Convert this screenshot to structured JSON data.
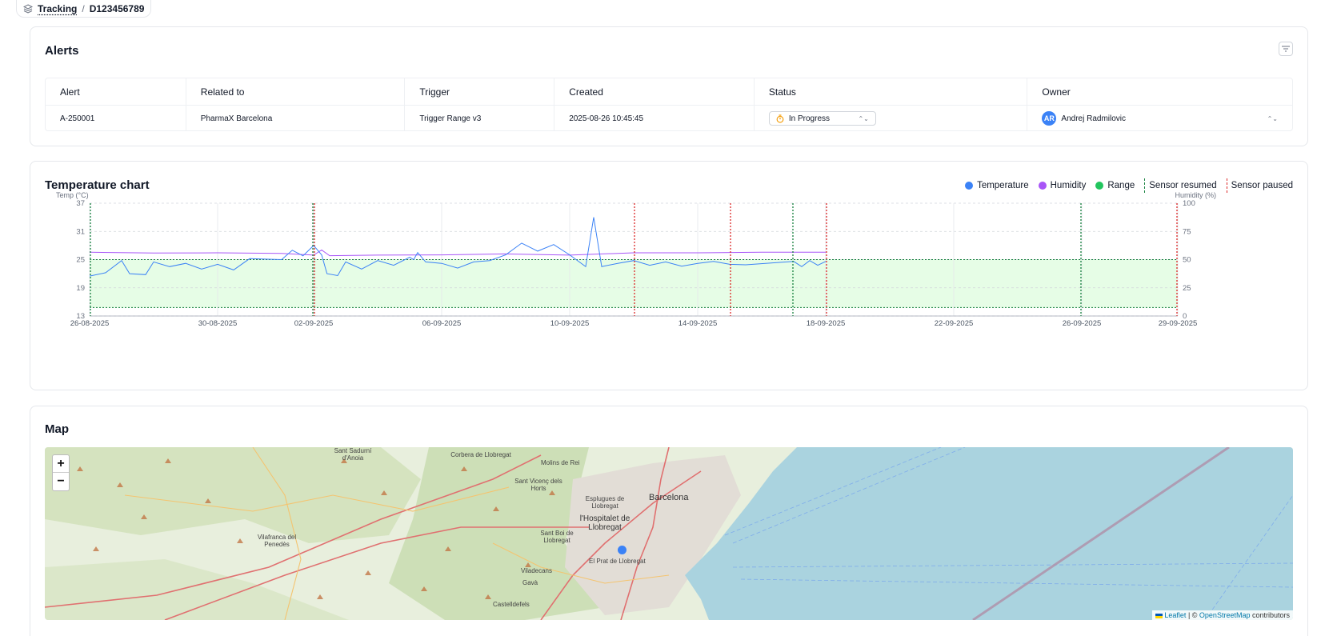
{
  "breadcrumb": {
    "root": "Tracking",
    "separator": "/",
    "current": "D123456789"
  },
  "alerts": {
    "title": "Alerts",
    "columns": [
      "Alert",
      "Related to",
      "Trigger",
      "Created",
      "Status",
      "Owner"
    ],
    "rows": [
      {
        "alert": "A-250001",
        "related": "PharmaX Barcelona",
        "trigger": "Trigger Range v3",
        "created": "2025-08-26 10:45:45",
        "status": "In Progress",
        "owner_initials": "AR",
        "owner": "Andrej Radmilovic"
      }
    ]
  },
  "chart": {
    "title": "Temperature chart",
    "legend": {
      "temperature": "Temperature",
      "humidity": "Humidity",
      "range": "Range",
      "resumed": "Sensor resumed",
      "paused": "Sensor paused"
    },
    "colors": {
      "temperature": "#3b82f6",
      "humidity": "#a855f7",
      "range": "#22c55e",
      "resumed": "#15803d",
      "paused": "#dc2626",
      "range_fill": "#e6fde6"
    }
  },
  "chart_data": {
    "type": "line",
    "ylabel": "Temp (°C)",
    "y2label": "Humidity (%)",
    "ylim": [
      13,
      37
    ],
    "y2lim": [
      0,
      100
    ],
    "yticks": [
      13,
      19,
      25,
      31,
      37
    ],
    "y2ticks": [
      0,
      25,
      50,
      75,
      100
    ],
    "xlim": [
      "2025-08-26",
      "2025-09-29"
    ],
    "xticks": [
      "26-08-2025",
      "30-08-2025",
      "02-09-2025",
      "06-09-2025",
      "10-09-2025",
      "14-09-2025",
      "18-09-2025",
      "22-09-2025",
      "26-09-2025",
      "29-09-2025"
    ],
    "range": [
      14.8,
      25
    ],
    "sensor_resumed": [
      "2025-08-26",
      "2025-09-02",
      "2025-09-17",
      "2025-09-26"
    ],
    "sensor_paused": [
      "2025-09-02",
      "2025-09-12",
      "2025-09-15",
      "2025-09-18",
      "2025-09-29"
    ],
    "series": [
      {
        "name": "Temperature",
        "points": [
          [
            "2025-08-26",
            21.5
          ],
          [
            "2025-08-26 12:00",
            22.2
          ],
          [
            "2025-08-27",
            24.8
          ],
          [
            "2025-08-27 06:00",
            22.0
          ],
          [
            "2025-08-27 18:00",
            21.8
          ],
          [
            "2025-08-28",
            24.5
          ],
          [
            "2025-08-28 12:00",
            23.5
          ],
          [
            "2025-08-29",
            24.2
          ],
          [
            "2025-08-29 12:00",
            23.0
          ],
          [
            "2025-08-30",
            24.0
          ],
          [
            "2025-08-30 12:00",
            22.8
          ],
          [
            "2025-08-31",
            25.2
          ],
          [
            "2025-09-01",
            25.0
          ],
          [
            "2025-09-01 08:00",
            27.0
          ],
          [
            "2025-09-01 16:00",
            25.8
          ],
          [
            "2025-09-02",
            28.0
          ],
          [
            "2025-09-02 06:00",
            26.0
          ],
          [
            "2025-09-02 10:00",
            22.0
          ],
          [
            "2025-09-02 18:00",
            21.6
          ],
          [
            "2025-09-03",
            24.5
          ],
          [
            "2025-09-03 12:00",
            23.0
          ],
          [
            "2025-09-04",
            24.8
          ],
          [
            "2025-09-04 12:00",
            23.8
          ],
          [
            "2025-09-05",
            25.5
          ],
          [
            "2025-09-05 03:00",
            25.0
          ],
          [
            "2025-09-05 06:00",
            26.5
          ],
          [
            "2025-09-05 12:00",
            24.5
          ],
          [
            "2025-09-06",
            24.2
          ],
          [
            "2025-09-06 12:00",
            23.2
          ],
          [
            "2025-09-07",
            24.5
          ],
          [
            "2025-09-07 12:00",
            24.8
          ],
          [
            "2025-09-08",
            26.0
          ],
          [
            "2025-09-08 12:00",
            28.5
          ],
          [
            "2025-09-09",
            26.8
          ],
          [
            "2025-09-09 12:00",
            28.2
          ],
          [
            "2025-09-10",
            26.0
          ],
          [
            "2025-09-10 12:00",
            23.5
          ],
          [
            "2025-09-10 18:00",
            34.0
          ],
          [
            "2025-09-11",
            23.5
          ],
          [
            "2025-09-11 12:00",
            24.2
          ],
          [
            "2025-09-12",
            24.8
          ],
          [
            "2025-09-12 12:00",
            23.8
          ],
          [
            "2025-09-13",
            24.5
          ],
          [
            "2025-09-13 12:00",
            23.6
          ],
          [
            "2025-09-14",
            24.2
          ],
          [
            "2025-09-14 12:00",
            24.6
          ],
          [
            "2025-09-15",
            24.0
          ],
          [
            "2025-09-15 12:00",
            23.9
          ],
          [
            "2025-09-17",
            24.6
          ],
          [
            "2025-09-17 06:00",
            23.5
          ],
          [
            "2025-09-17 12:00",
            24.8
          ],
          [
            "2025-09-17 18:00",
            23.8
          ],
          [
            "2025-09-18",
            24.6
          ]
        ]
      },
      {
        "name": "Humidity",
        "points": [
          [
            "2025-08-26",
            56.5
          ],
          [
            "2025-08-28",
            55.8
          ],
          [
            "2025-08-30",
            56.0
          ],
          [
            "2025-09-01",
            55.5
          ],
          [
            "2025-09-02",
            54.0
          ],
          [
            "2025-09-02 06:00",
            58.5
          ],
          [
            "2025-09-02 12:00",
            53.5
          ],
          [
            "2025-09-04",
            54.0
          ],
          [
            "2025-09-06",
            54.2
          ],
          [
            "2025-09-08",
            55.0
          ],
          [
            "2025-09-10",
            54.0
          ],
          [
            "2025-09-12",
            56.0
          ],
          [
            "2025-09-14",
            56.0
          ],
          [
            "2025-09-16",
            56.5
          ],
          [
            "2025-09-18",
            56.5
          ]
        ]
      }
    ]
  },
  "map": {
    "title": "Map",
    "zoom_in": "+",
    "zoom_out": "−",
    "place_labels": [
      "Barcelona",
      "Corbera de Llobregat",
      "Molins de Rei",
      "Sant Vicenç dels Horts",
      "Esplugues de Llobregat",
      "l'Hospitalet de Llobregat",
      "Sant Boi de Llobregat",
      "El Prat de Llobregat",
      "Viladecans",
      "Gavà",
      "Castelldefels",
      "Vilafranca del Penedès",
      "Sant Sadurní d'Anoia"
    ],
    "attribution_leaflet": "Leaflet",
    "attribution_sep": " | © ",
    "attribution_osm": "OpenStreetMap",
    "attribution_rest": " contributors",
    "colors": {
      "sea": "#aad3df",
      "land": "#e8efdd",
      "forest": "#c8dcb0",
      "urban": "#e0ddd8",
      "road_major": "#e07070",
      "road_minor": "#f4c470",
      "marker": "#3b82f6"
    }
  }
}
